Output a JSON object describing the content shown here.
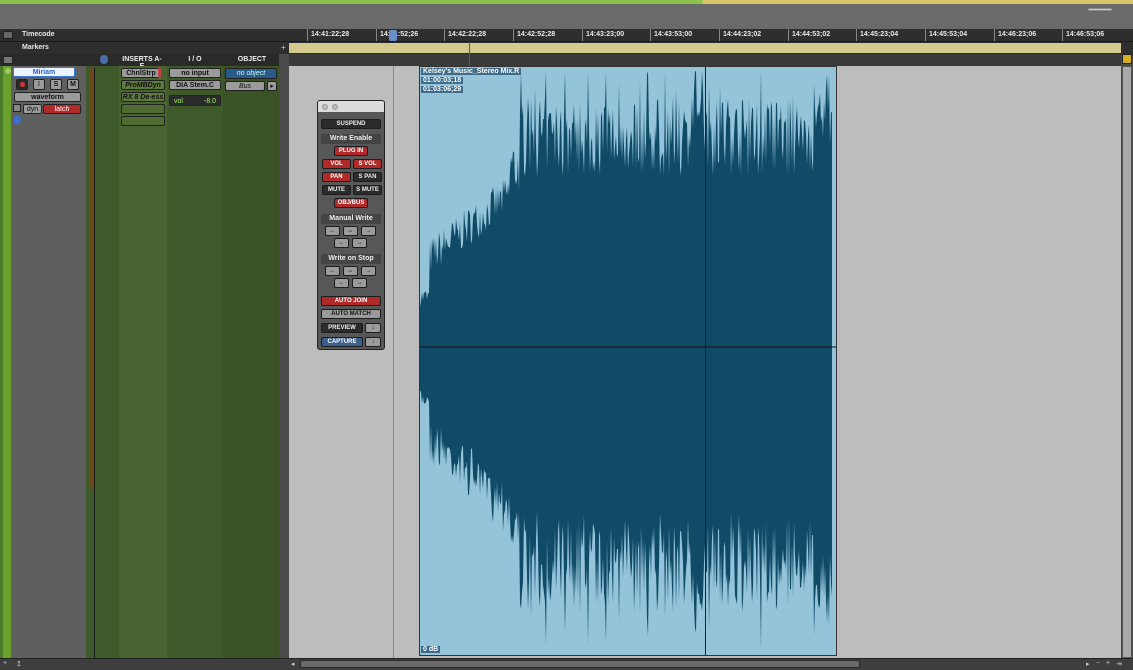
{
  "ruler": {
    "label": "Timecode",
    "ticks": [
      "14:41:22;28",
      "14:41:52;26",
      "14:42:22;28",
      "14:42:52;28",
      "14:43:23;00",
      "14:43:53;00",
      "14:44:23;02",
      "14:44:53;02",
      "14:45:23;04",
      "14:45:53;04",
      "14:46:23;06",
      "14:46:53;06"
    ]
  },
  "markers": {
    "label": "Markers"
  },
  "columns": {
    "inserts": "INSERTS A-E",
    "io": "I / O",
    "object": "OBJECT"
  },
  "track": {
    "name": "Miriam",
    "view": "waveform",
    "dyn": "dyn",
    "auto_mode": "latch",
    "solo": "S",
    "mute": "M",
    "inserts": [
      "ChnlStrp",
      "ProMBDyn",
      "RX 8 De-ess"
    ],
    "input": "no input",
    "output": "DIA Stem.C",
    "vol_label": "vol",
    "vol_value": "-8.0",
    "object": "no object",
    "bus": "Bus"
  },
  "clip": {
    "name": "Kelsey's Music_Stereo Mix.R",
    "start": "01:00:03;18",
    "end": "01:03:06;29",
    "gain": "0 dB"
  },
  "automation": {
    "suspend": "SUSPEND",
    "write_enable": "Write Enable",
    "plugin": "PLUG IN",
    "vol": "VOL",
    "svol": "S VOL",
    "pan": "PAN",
    "span": "S PAN",
    "mute": "MUTE",
    "smute": "S MUTE",
    "objbus": "OBJ/BUS",
    "manual_write": "Manual Write",
    "write_on_stop": "Write on Stop",
    "auto_join": "AUTO JOIN",
    "auto_match": "AUTO MATCH",
    "preview": "PREVIEW",
    "capture": "CAPTURE"
  },
  "icons": {
    "left_arrow": "←",
    "right_arrow": "→",
    "both_arrow": "↔",
    "down_arrow": "↓"
  },
  "colors": {
    "waveform_fill": "#0f4a66",
    "clip_bg": "#94c3da",
    "record_red": "#b02a2a",
    "capture_blue": "#3a5f8a",
    "marker_lane": "#d4c98f"
  }
}
